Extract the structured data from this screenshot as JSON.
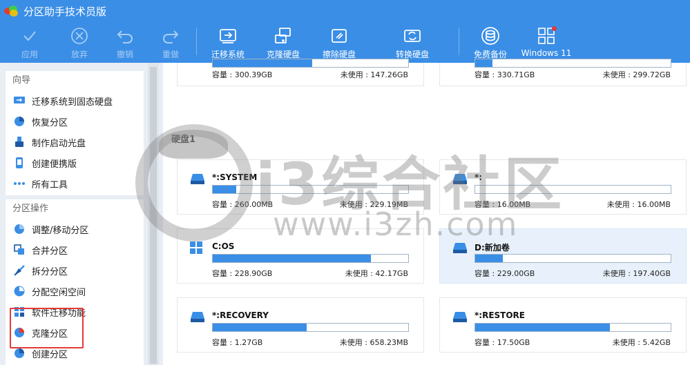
{
  "app": {
    "title": "分区助手技术员版"
  },
  "toolbar": {
    "apply": "应用",
    "discard": "放弃",
    "undo": "撤销",
    "redo": "重做",
    "migrate": "迁移系统",
    "clone": "克隆硬盘",
    "wipe": "擦除硬盘",
    "convert": "转换硬盘",
    "backup": "免费备份",
    "windows11": "Windows 11"
  },
  "sidebar": {
    "wizard_title": "向导",
    "wizard_items": [
      {
        "label": "迁移系统到固态硬盘",
        "icon": "migrate-ssd-icon"
      },
      {
        "label": "恢复分区",
        "icon": "restore-partition-icon"
      },
      {
        "label": "制作启动光盘",
        "icon": "bootable-media-icon"
      },
      {
        "label": "创建便携版",
        "icon": "portable-icon"
      },
      {
        "label": "所有工具",
        "icon": "all-tools-icon"
      }
    ],
    "ops_title": "分区操作",
    "ops_items": [
      {
        "label": "调整/移动分区",
        "icon": "resize-icon"
      },
      {
        "label": "合并分区",
        "icon": "merge-icon"
      },
      {
        "label": "拆分分区",
        "icon": "split-icon"
      },
      {
        "label": "分配空闲空间",
        "icon": "allocate-icon"
      },
      {
        "label": "软件迁移功能",
        "icon": "app-mover-icon"
      },
      {
        "label": "克隆分区",
        "icon": "clone-partition-icon"
      },
      {
        "label": "创建分区",
        "icon": "create-partition-icon"
      }
    ]
  },
  "disks": {
    "disk1_label": "硬盘1",
    "top_left": {
      "cap": "容量 : 300.39GB",
      "free": "未使用 : 147.26GB"
    },
    "top_right": {
      "cap": "容量 : 330.71GB",
      "free": "未使用 : 299.72GB"
    },
    "partitions": [
      {
        "name": "*:SYSTEM",
        "cap": "容量 : 260.00MB",
        "free": "未使用 : 229.19MB",
        "used_fraction": 0.12,
        "icon": "efi-drive-icon"
      },
      {
        "name": "*:",
        "cap": "容量 : 16.00MB",
        "free": "未使用 : 16.00MB",
        "used_fraction": 0.0,
        "icon": "drive-icon"
      },
      {
        "name": "C:OS",
        "cap": "容量 : 228.90GB",
        "free": "未使用 : 42.17GB",
        "used_fraction": 0.81,
        "icon": "windows-icon"
      },
      {
        "name": "D:新加卷",
        "cap": "容量 : 229.00GB",
        "free": "未使用 : 197.40GB",
        "used_fraction": 0.14,
        "icon": "drive-icon"
      },
      {
        "name": "*:RECOVERY",
        "cap": "容量 : 1.27GB",
        "free": "未使用 : 658.23MB",
        "used_fraction": 0.48,
        "icon": "drive-icon"
      },
      {
        "name": "*:RESTORE",
        "cap": "容量 : 17.50GB",
        "free": "未使用 : 5.42GB",
        "used_fraction": 0.69,
        "icon": "drive-icon"
      }
    ]
  },
  "watermark": {
    "cn": "i3综合社区",
    "url": "www.i3zh.com"
  },
  "colors": {
    "accent": "#3a8ee6",
    "highlight": "#e53935"
  }
}
